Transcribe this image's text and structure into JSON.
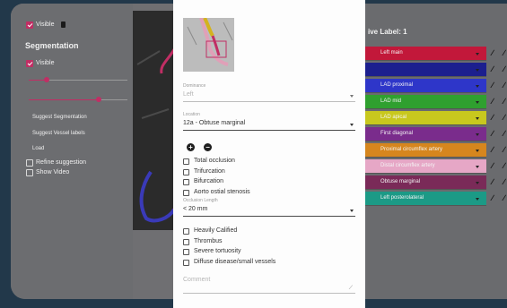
{
  "sidebar": {
    "visible_top_label": "Visible",
    "segmentation_title": "Segmentation",
    "visible_label": "Visible",
    "suggest_segmentation": "Suggest Segmentation",
    "suggest_vessel_labels": "Suggest Vessel labels",
    "load": "Load",
    "refine_suggestion": "Refine suggestion",
    "show_video": "Show Video"
  },
  "right_panel": {
    "active_label_title": "ive Label: 1",
    "rows": [
      {
        "label": "Left main",
        "color": "#c2183a"
      },
      {
        "label": "",
        "color": "#1c1f8e"
      },
      {
        "label": "LAD proximal",
        "color": "#2e36c9"
      },
      {
        "label": "LAD mid",
        "color": "#2fa02f"
      },
      {
        "label": "LAD apical",
        "color": "#c8c81e"
      },
      {
        "label": "First diagonal",
        "color": "#7a2c8c"
      },
      {
        "label": "Proximal circumflex artery",
        "color": "#d6861e"
      },
      {
        "label": "Distal circumflex artery",
        "color": "#e6a7c6"
      },
      {
        "label": "Obtuse marginal",
        "color": "#7a2a58"
      },
      {
        "label": "Left posterolateral",
        "color": "#1c9a86"
      }
    ]
  },
  "modal": {
    "dominance_label": "Dominance",
    "dominance_value": "Left",
    "location_label": "Location",
    "location_value": "12a - Obtuse marginal",
    "checkboxes_a": [
      "Total occlusion",
      "Trifurcation",
      "Bifurcation",
      "Aorto ostial stenosis"
    ],
    "occlusion_length_label": "Occlusion Length",
    "occlusion_length_value": "< 20 mm",
    "checkboxes_b": [
      "Heavily Calified",
      "Thrombus",
      "Severe tortuosity",
      "Diffuse disease/small vessels"
    ],
    "comment_placeholder": "Comment"
  },
  "colors": {
    "accent": "#c12e64",
    "background": "#22384a"
  }
}
